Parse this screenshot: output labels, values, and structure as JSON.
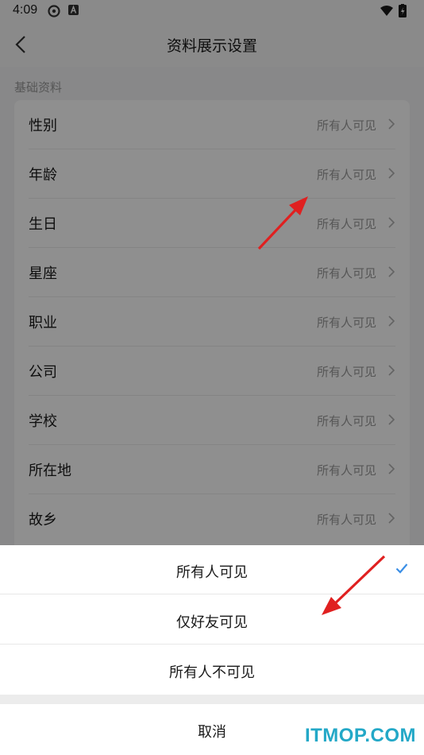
{
  "status": {
    "time": "4:09",
    "icons": [
      "sync-icon",
      "app-a-icon",
      "wifi-icon",
      "battery-icon"
    ]
  },
  "header": {
    "title": "资料展示设置",
    "back_icon": "chevron-left-icon"
  },
  "section": {
    "label": "基础资料"
  },
  "rows": [
    {
      "label": "性别",
      "value": "所有人可见"
    },
    {
      "label": "年龄",
      "value": "所有人可见"
    },
    {
      "label": "生日",
      "value": "所有人可见"
    },
    {
      "label": "星座",
      "value": "所有人可见"
    },
    {
      "label": "职业",
      "value": "所有人可见"
    },
    {
      "label": "公司",
      "value": "所有人可见"
    },
    {
      "label": "学校",
      "value": "所有人可见"
    },
    {
      "label": "所在地",
      "value": "所有人可见"
    },
    {
      "label": "故乡",
      "value": "所有人可见"
    }
  ],
  "sheet": {
    "options": [
      {
        "label": "所有人可见",
        "selected": true
      },
      {
        "label": "仅好友可见",
        "selected": false
      },
      {
        "label": "所有人不可见",
        "selected": false
      }
    ],
    "cancel": "取消"
  },
  "watermark": "ITMOP.COM",
  "colors": {
    "accent": "#3a8ee6",
    "annotation_arrow": "#e02020",
    "watermark": "#23a8c7"
  }
}
